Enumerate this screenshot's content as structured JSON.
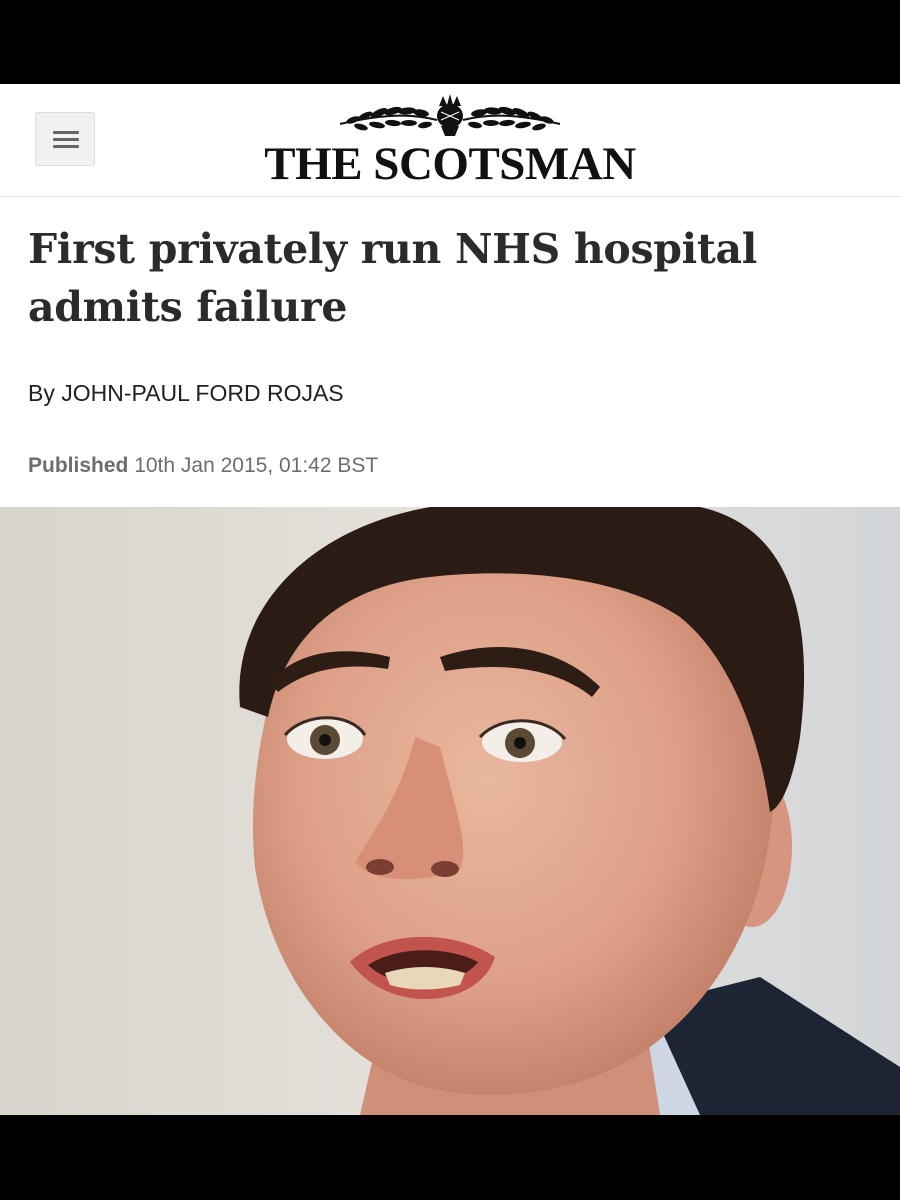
{
  "header": {
    "menu_icon": "hamburger-menu-icon",
    "masthead": "THE SCOTSMAN",
    "emblem_icon": "thistle-emblem-icon"
  },
  "article": {
    "headline": "First privately run NHS hospital admits failure",
    "byline": "By JOHN-PAUL FORD ROJAS",
    "published_label": "Published",
    "published_date": "10th Jan 2015, 01:42 BST"
  },
  "image": {
    "subject": "portrait-photo"
  },
  "colors": {
    "headline": "#2b2b2b",
    "meta_gray": "#6d6d6d",
    "frame": "#000000"
  }
}
